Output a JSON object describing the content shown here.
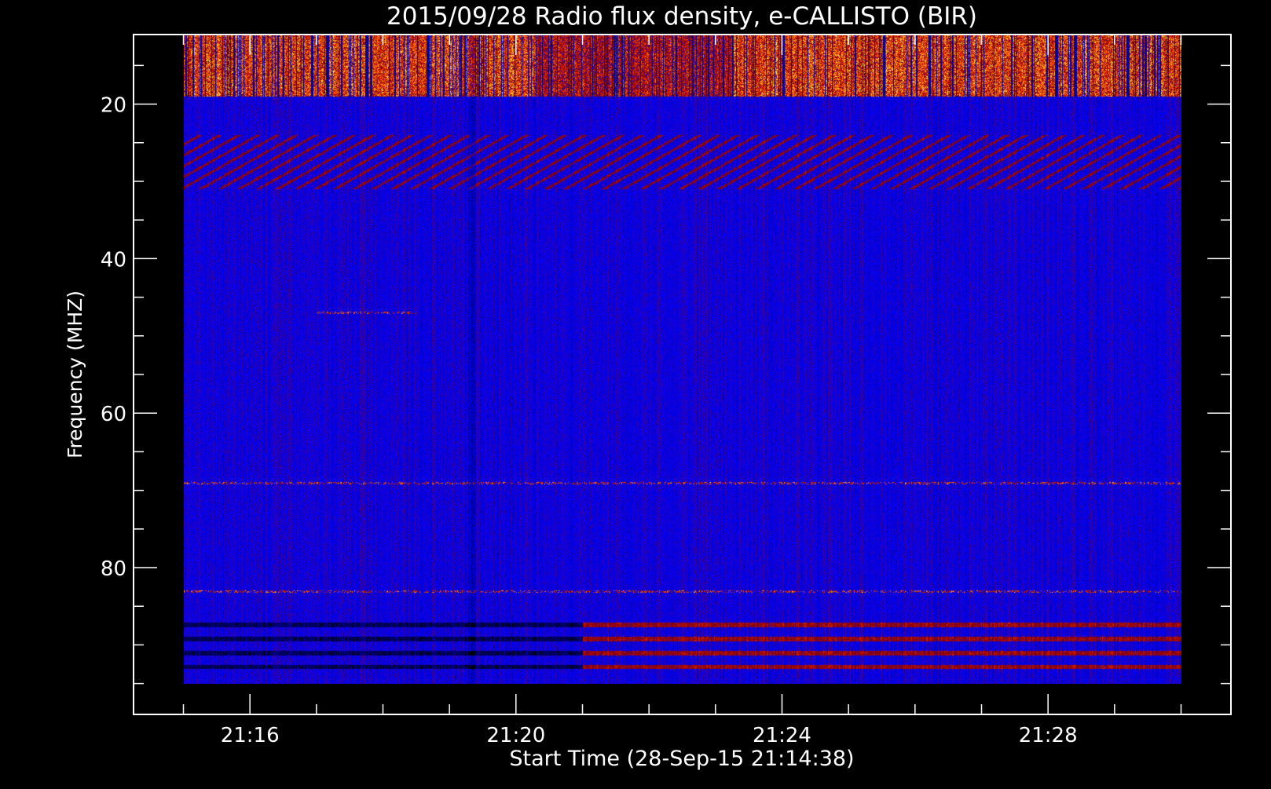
{
  "chart_data": {
    "type": "heatmap",
    "title": "2015/09/28  Radio flux density, e-CALLISTO (BIR)",
    "xlabel": "Start Time (28-Sep-15 21:14:38)",
    "ylabel": "Frequency (MHZ)",
    "x": {
      "start": "21:15:00",
      "end": "21:30:00",
      "unit": "time"
    },
    "xlim": [
      "21:14:15",
      "21:30:45"
    ],
    "xticks": [
      "21:16",
      "21:20",
      "21:24",
      "21:28"
    ],
    "ylim": [
      99,
      11
    ],
    "y_inverted": true,
    "y_data_range": [
      11,
      95
    ],
    "yticks": [
      "20",
      "40",
      "60",
      "80"
    ],
    "colormap": [
      "#000000",
      "#0000ff",
      "#8b0000",
      "#ff3000",
      "#ffa000",
      "#ffff80"
    ],
    "features": [
      {
        "kind": "intense emission",
        "freq_range": [
          11,
          19
        ],
        "time_range": [
          "21:15",
          "21:30"
        ]
      },
      {
        "kind": "dim vertical band",
        "freq_range": [
          11,
          95
        ],
        "time": "21:19:20"
      },
      {
        "kind": "drifting stripes",
        "freq_range": [
          24,
          31
        ],
        "time_range": [
          "21:15",
          "21:30"
        ]
      },
      {
        "kind": "narrowband line",
        "freq": 47,
        "time_range": [
          "21:17",
          "21:18:30"
        ]
      },
      {
        "kind": "narrowband line",
        "freq": 69,
        "time_range": [
          "21:15",
          "21:30"
        ]
      },
      {
        "kind": "narrowband line",
        "freq": 83,
        "time_range": [
          "21:15",
          "21:30"
        ]
      },
      {
        "kind": "dark lines",
        "freq_range": [
          87,
          93
        ],
        "time_range": [
          "21:15",
          "21:21"
        ]
      },
      {
        "kind": "red lines",
        "freq_range": [
          87,
          93
        ],
        "time_range": [
          "21:21",
          "21:30"
        ]
      }
    ]
  }
}
